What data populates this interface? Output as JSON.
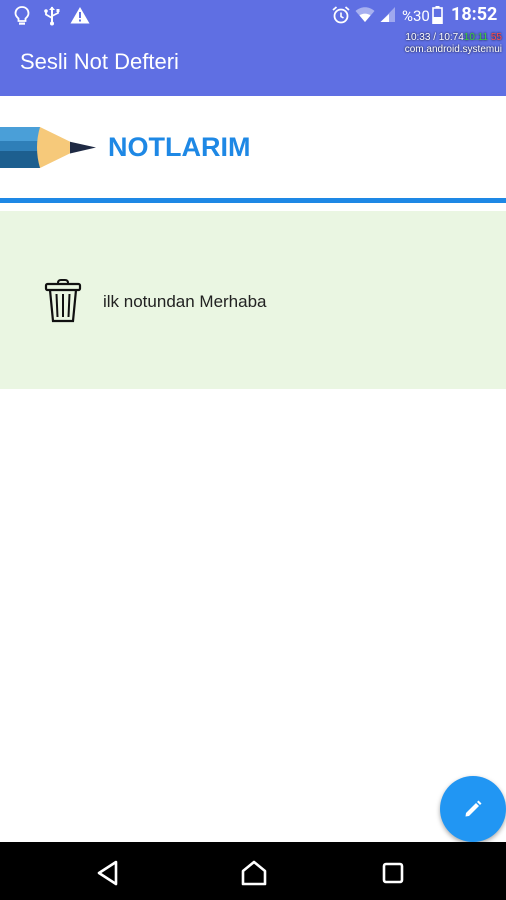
{
  "status_bar": {
    "icons": [
      "bulb-icon",
      "usb-icon",
      "warning-icon",
      "alarm-icon",
      "wifi-icon",
      "signal-icon",
      "battery-icon"
    ],
    "battery": "%30",
    "clock": "18:52"
  },
  "debug_overlay": {
    "line1_prefix": "10:33 / 10:74",
    "line1_green": "10:11",
    "line1_red": "55",
    "line2": "com.android.systemui"
  },
  "app": {
    "title": "Sesli Not Defteri",
    "colors": {
      "appbar": "#5f6fe3",
      "accent": "#1e88e5",
      "note_bg": "#eaf6e2"
    }
  },
  "header": {
    "title": "NOTLARIM",
    "logo_icon": "pencil-icon"
  },
  "notes": [
    {
      "text": "ilk notundan Merhaba",
      "icon": "trash-icon"
    }
  ],
  "fab": {
    "icon": "pencil-icon"
  },
  "navbar": {
    "icons": [
      "back-icon",
      "home-icon",
      "recents-icon"
    ]
  }
}
